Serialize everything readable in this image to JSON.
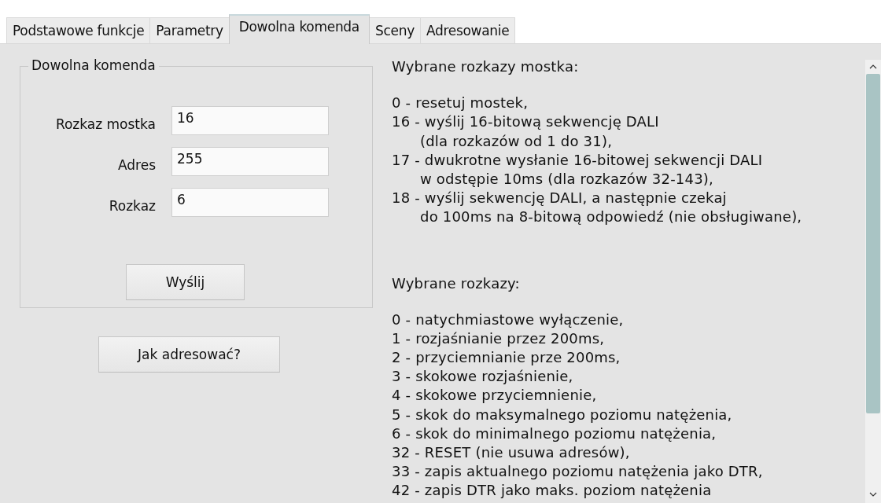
{
  "tabs": [
    {
      "label": "Podstawowe funkcje",
      "selected": false
    },
    {
      "label": "Parametry",
      "selected": false
    },
    {
      "label": "Dowolna komenda",
      "selected": true
    },
    {
      "label": "Sceny",
      "selected": false
    },
    {
      "label": "Adresowanie",
      "selected": false
    }
  ],
  "group": {
    "title": "Dowolna komenda",
    "fields": [
      {
        "label": "Rozkaz mostka",
        "value": "16"
      },
      {
        "label": "Adres",
        "value": "255"
      },
      {
        "label": "Rozkaz",
        "value": "6"
      }
    ],
    "send_button": "Wyślij"
  },
  "help_button": "Jak adresować?",
  "info": [
    {
      "heading": "Wybrane rozkazy mostka:",
      "entries": [
        {
          "lines": [
            "0 - resetuj mostek,"
          ]
        },
        {
          "lines": [
            "16 - wyślij 16-bitową sekwencję DALI",
            "(dla rozkazów od 1 do 31),"
          ]
        },
        {
          "lines": [
            "17 - dwukrotne wysłanie 16-bitowej sekwencji DALI",
            "w odstępie 10ms (dla rozkazów 32-143),"
          ]
        },
        {
          "lines": [
            "18 - wyślij sekwencję DALI, a następnie czekaj",
            "do 100ms na 8-bitową odpowiedź (nie obsługiwane),"
          ]
        }
      ]
    },
    {
      "heading": "Wybrane rozkazy:",
      "entries": [
        {
          "lines": [
            "0 - natychmiastowe wyłączenie,"
          ]
        },
        {
          "lines": [
            "1 - rozjaśnianie przez 200ms,"
          ]
        },
        {
          "lines": [
            "2 - przyciemnianie prze 200ms,"
          ]
        },
        {
          "lines": [
            "3 - skokowe rozjaśnienie,"
          ]
        },
        {
          "lines": [
            "4 - skokowe przyciemnienie,"
          ]
        },
        {
          "lines": [
            "5 - skok do maksymalnego poziomu natężenia,"
          ]
        },
        {
          "lines": [
            "6 - skok do minimalnego poziomu natężenia,"
          ]
        },
        {
          "lines": [
            "32 - RESET (nie usuwa adresów),"
          ]
        },
        {
          "lines": [
            "33 - zapis aktualnego poziomu natężenia jako DTR,"
          ]
        },
        {
          "lines": [
            "42 - zapis DTR jako maks. poziom natężenia"
          ]
        }
      ]
    }
  ]
}
